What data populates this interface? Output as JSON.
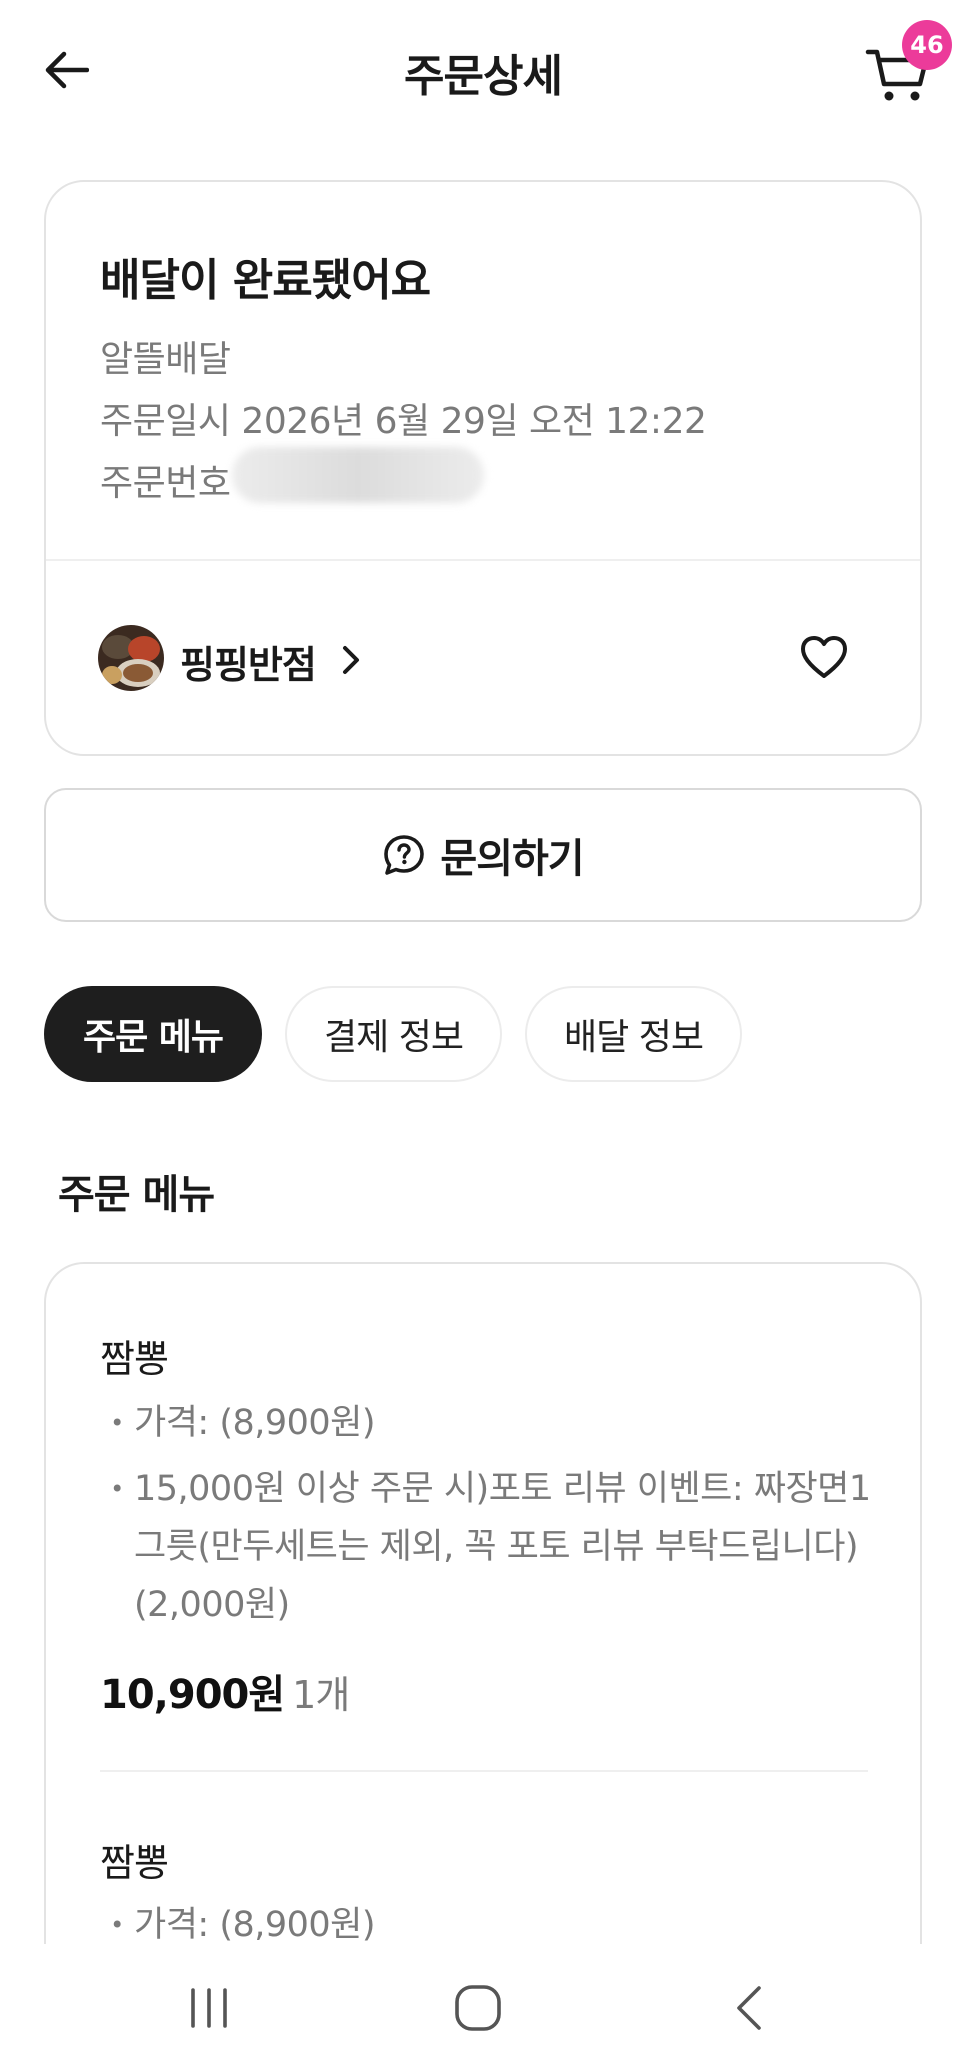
{
  "header": {
    "title": "주문상세",
    "cart_count": "46",
    "icons": {
      "back": "arrow-left-icon",
      "cart": "cart-icon"
    }
  },
  "order": {
    "status_title": "배달이 완료됐어요",
    "delivery_type": "알뜰배달",
    "order_datetime": "주문일시 2026년 6월 29일 오전 12:22",
    "order_number_label": "주문번호",
    "store_name": "핑핑반점"
  },
  "inquiry": {
    "label": "문의하기"
  },
  "tabs": [
    {
      "label": "주문 메뉴",
      "active": true
    },
    {
      "label": "결제 정보",
      "active": false
    },
    {
      "label": "배달 정보",
      "active": false
    }
  ],
  "menu_section": {
    "title": "주문 메뉴",
    "items": [
      {
        "name": "짬뽕",
        "options": [
          "가격:  (8,900원)",
          "15,000원 이상 주문 시)포토 리뷰 이벤트: 짜장면1",
          "그릇(만두세트는 제외, 꼭 포토 리뷰 부탁드립니다)",
          "(2,000원)"
        ],
        "price": "10,900원",
        "qty": "1개"
      },
      {
        "name": "짬뽕",
        "options": [
          "가격:  (8,900원)"
        ]
      }
    ]
  },
  "colors": {
    "accent": "#ec3b9a",
    "active_tab": "#1e1e1e",
    "muted_text": "#7a7a7a"
  }
}
